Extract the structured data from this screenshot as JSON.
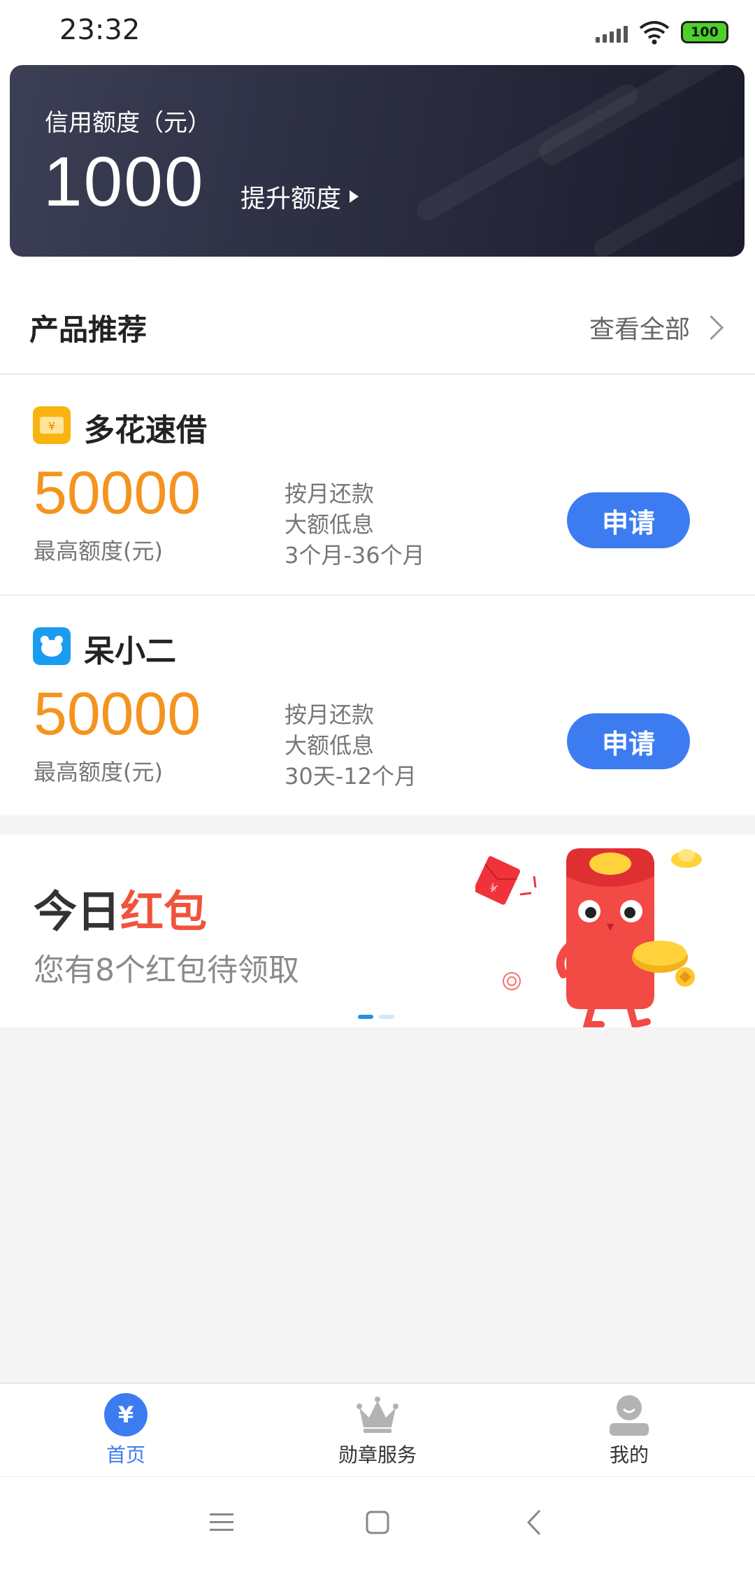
{
  "status_bar": {
    "time": "23:32",
    "battery": "100"
  },
  "credit": {
    "label": "信用额度（元）",
    "amount": "1000",
    "raise_label": "提升额度"
  },
  "products_section": {
    "title": "产品推荐",
    "view_all": "查看全部"
  },
  "products": [
    {
      "name": "多花速借",
      "icon": "yen-card-icon",
      "amount": "50000",
      "amount_label": "最高额度(元)",
      "features": [
        "按月还款",
        "大额低息",
        "3个月-36个月"
      ],
      "apply_label": "申请"
    },
    {
      "name": "呆小二",
      "icon": "bear-face-icon",
      "amount": "50000",
      "amount_label": "最高额度(元)",
      "features": [
        "按月还款",
        "大额低息",
        "30天-12个月"
      ],
      "apply_label": "申请"
    }
  ],
  "banner": {
    "title_prefix": "今日",
    "title_highlight": "红包",
    "subtitle": "您有8个红包待领取",
    "page_count": 2,
    "active_page": 1
  },
  "tabs": [
    {
      "label": "首页",
      "icon": "yen-circle-icon",
      "active": true
    },
    {
      "label": "勋章服务",
      "icon": "crown-icon",
      "active": false
    },
    {
      "label": "我的",
      "icon": "user-icon",
      "active": false
    }
  ],
  "colors": {
    "accent": "#3d7cf0",
    "amount": "#f5931f",
    "banner_highlight": "#f0533b",
    "card_dark": "#2c2e42"
  }
}
